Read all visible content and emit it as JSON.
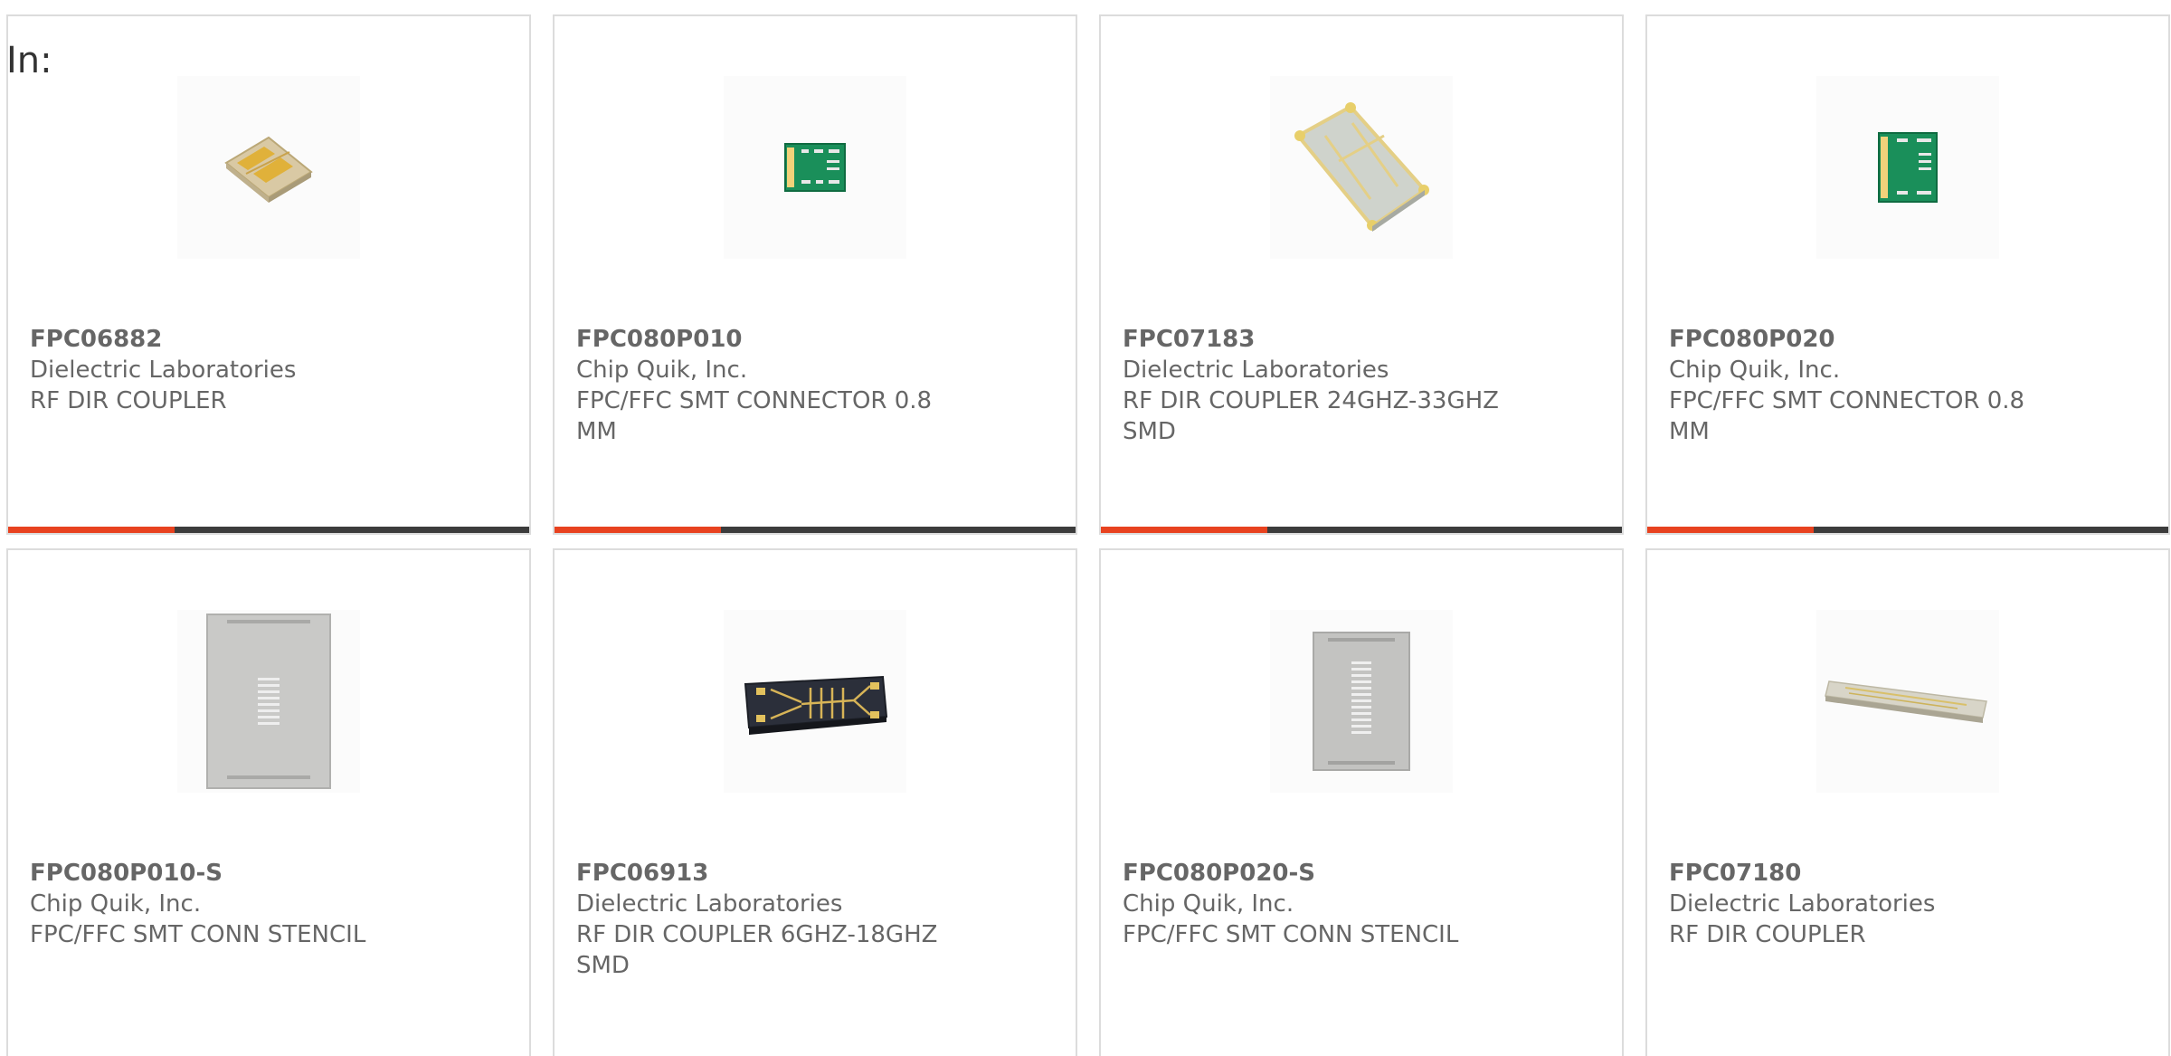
{
  "in_label": "In:",
  "colors": {
    "progress_accent": "#e8421f",
    "progress_track": "#3c3c3c",
    "text": "#666666",
    "border": "#dcdcdc"
  },
  "products": [
    {
      "part_number": "FPC06882",
      "manufacturer": "Dielectric Laboratories",
      "description": "RF DIR COUPLER",
      "image": "gold-chip-coupler-image",
      "progress": 0.32
    },
    {
      "part_number": "FPC080P010",
      "manufacturer": "Chip Quik, Inc.",
      "description": "FPC/FFC SMT CONNECTOR 0.8 MM",
      "image": "green-adapter-board-image",
      "progress": 0.32
    },
    {
      "part_number": "FPC07183",
      "manufacturer": "Dielectric Laboratories",
      "description": "RF DIR COUPLER 24GHZ-33GHZ SMD",
      "image": "ceramic-coupler-image",
      "progress": 0.32
    },
    {
      "part_number": "FPC080P020",
      "manufacturer": "Chip Quik, Inc.",
      "description": "FPC/FFC SMT CONNECTOR 0.8 MM",
      "image": "green-adapter-board-image",
      "progress": 0.32
    },
    {
      "part_number": "FPC080P010-S",
      "manufacturer": "Chip Quik, Inc.",
      "description": "FPC/FFC SMT CONN STENCIL",
      "image": "stencil-image",
      "progress": null
    },
    {
      "part_number": "FPC06913",
      "manufacturer": "Dielectric Laboratories",
      "description": "RF DIR COUPLER 6GHZ-18GHZ SMD",
      "image": "dark-coupler-image",
      "progress": null
    },
    {
      "part_number": "FPC080P020-S",
      "manufacturer": "Chip Quik, Inc.",
      "description": "FPC/FFC SMT CONN STENCIL",
      "image": "stencil-image",
      "progress": null
    },
    {
      "part_number": "FPC07180",
      "manufacturer": "Dielectric Laboratories",
      "description": "RF DIR COUPLER",
      "image": "long-ceramic-strip-image",
      "progress": null
    }
  ]
}
